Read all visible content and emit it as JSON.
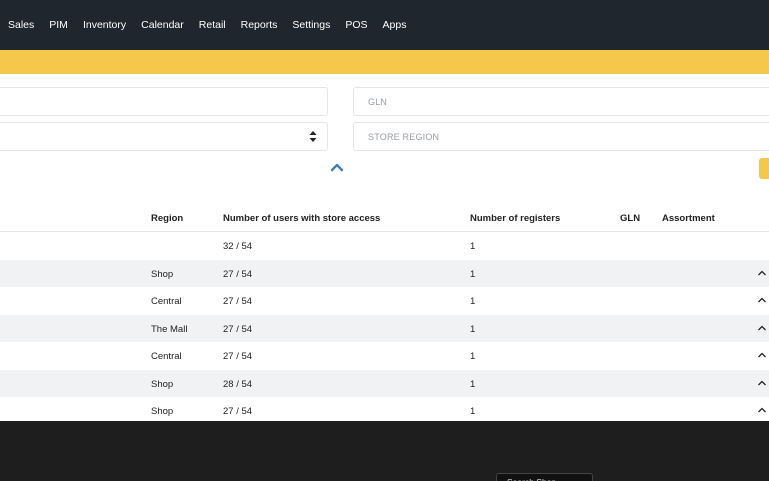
{
  "nav": {
    "items": [
      "Sales",
      "PIM",
      "Inventory",
      "Calendar",
      "Retail",
      "Reports",
      "Settings",
      "POS",
      "Apps"
    ]
  },
  "filters": {
    "gln_placeholder": "GLN",
    "region_placeholder": "STORE REGION"
  },
  "table": {
    "headers": {
      "region": "Region",
      "users": "Number of users with store access",
      "registers": "Number of registers",
      "gln": "GLN",
      "assortment": "Assortment"
    },
    "rows": [
      {
        "region": "",
        "users": "32 / 54",
        "registers": "1",
        "chevron": false
      },
      {
        "region": "Shop",
        "users": "27 / 54",
        "registers": "1",
        "chevron": true
      },
      {
        "region": "Central",
        "users": "27 / 54",
        "registers": "1",
        "chevron": true
      },
      {
        "region": "The Mall",
        "users": "27 / 54",
        "registers": "1",
        "chevron": true
      },
      {
        "region": "Central",
        "users": "27 / 54",
        "registers": "1",
        "chevron": true
      },
      {
        "region": "Shop",
        "users": "28 / 54",
        "registers": "1",
        "chevron": true
      },
      {
        "region": "Shop",
        "users": "27 / 54",
        "registers": "1",
        "chevron": true
      }
    ]
  },
  "overlay": {
    "tooltip": "Search Shop..."
  },
  "colors": {
    "nav_bg": "#1f262e",
    "accent_yellow": "#f5c84b",
    "toggle_blue": "#3f7fb8"
  }
}
